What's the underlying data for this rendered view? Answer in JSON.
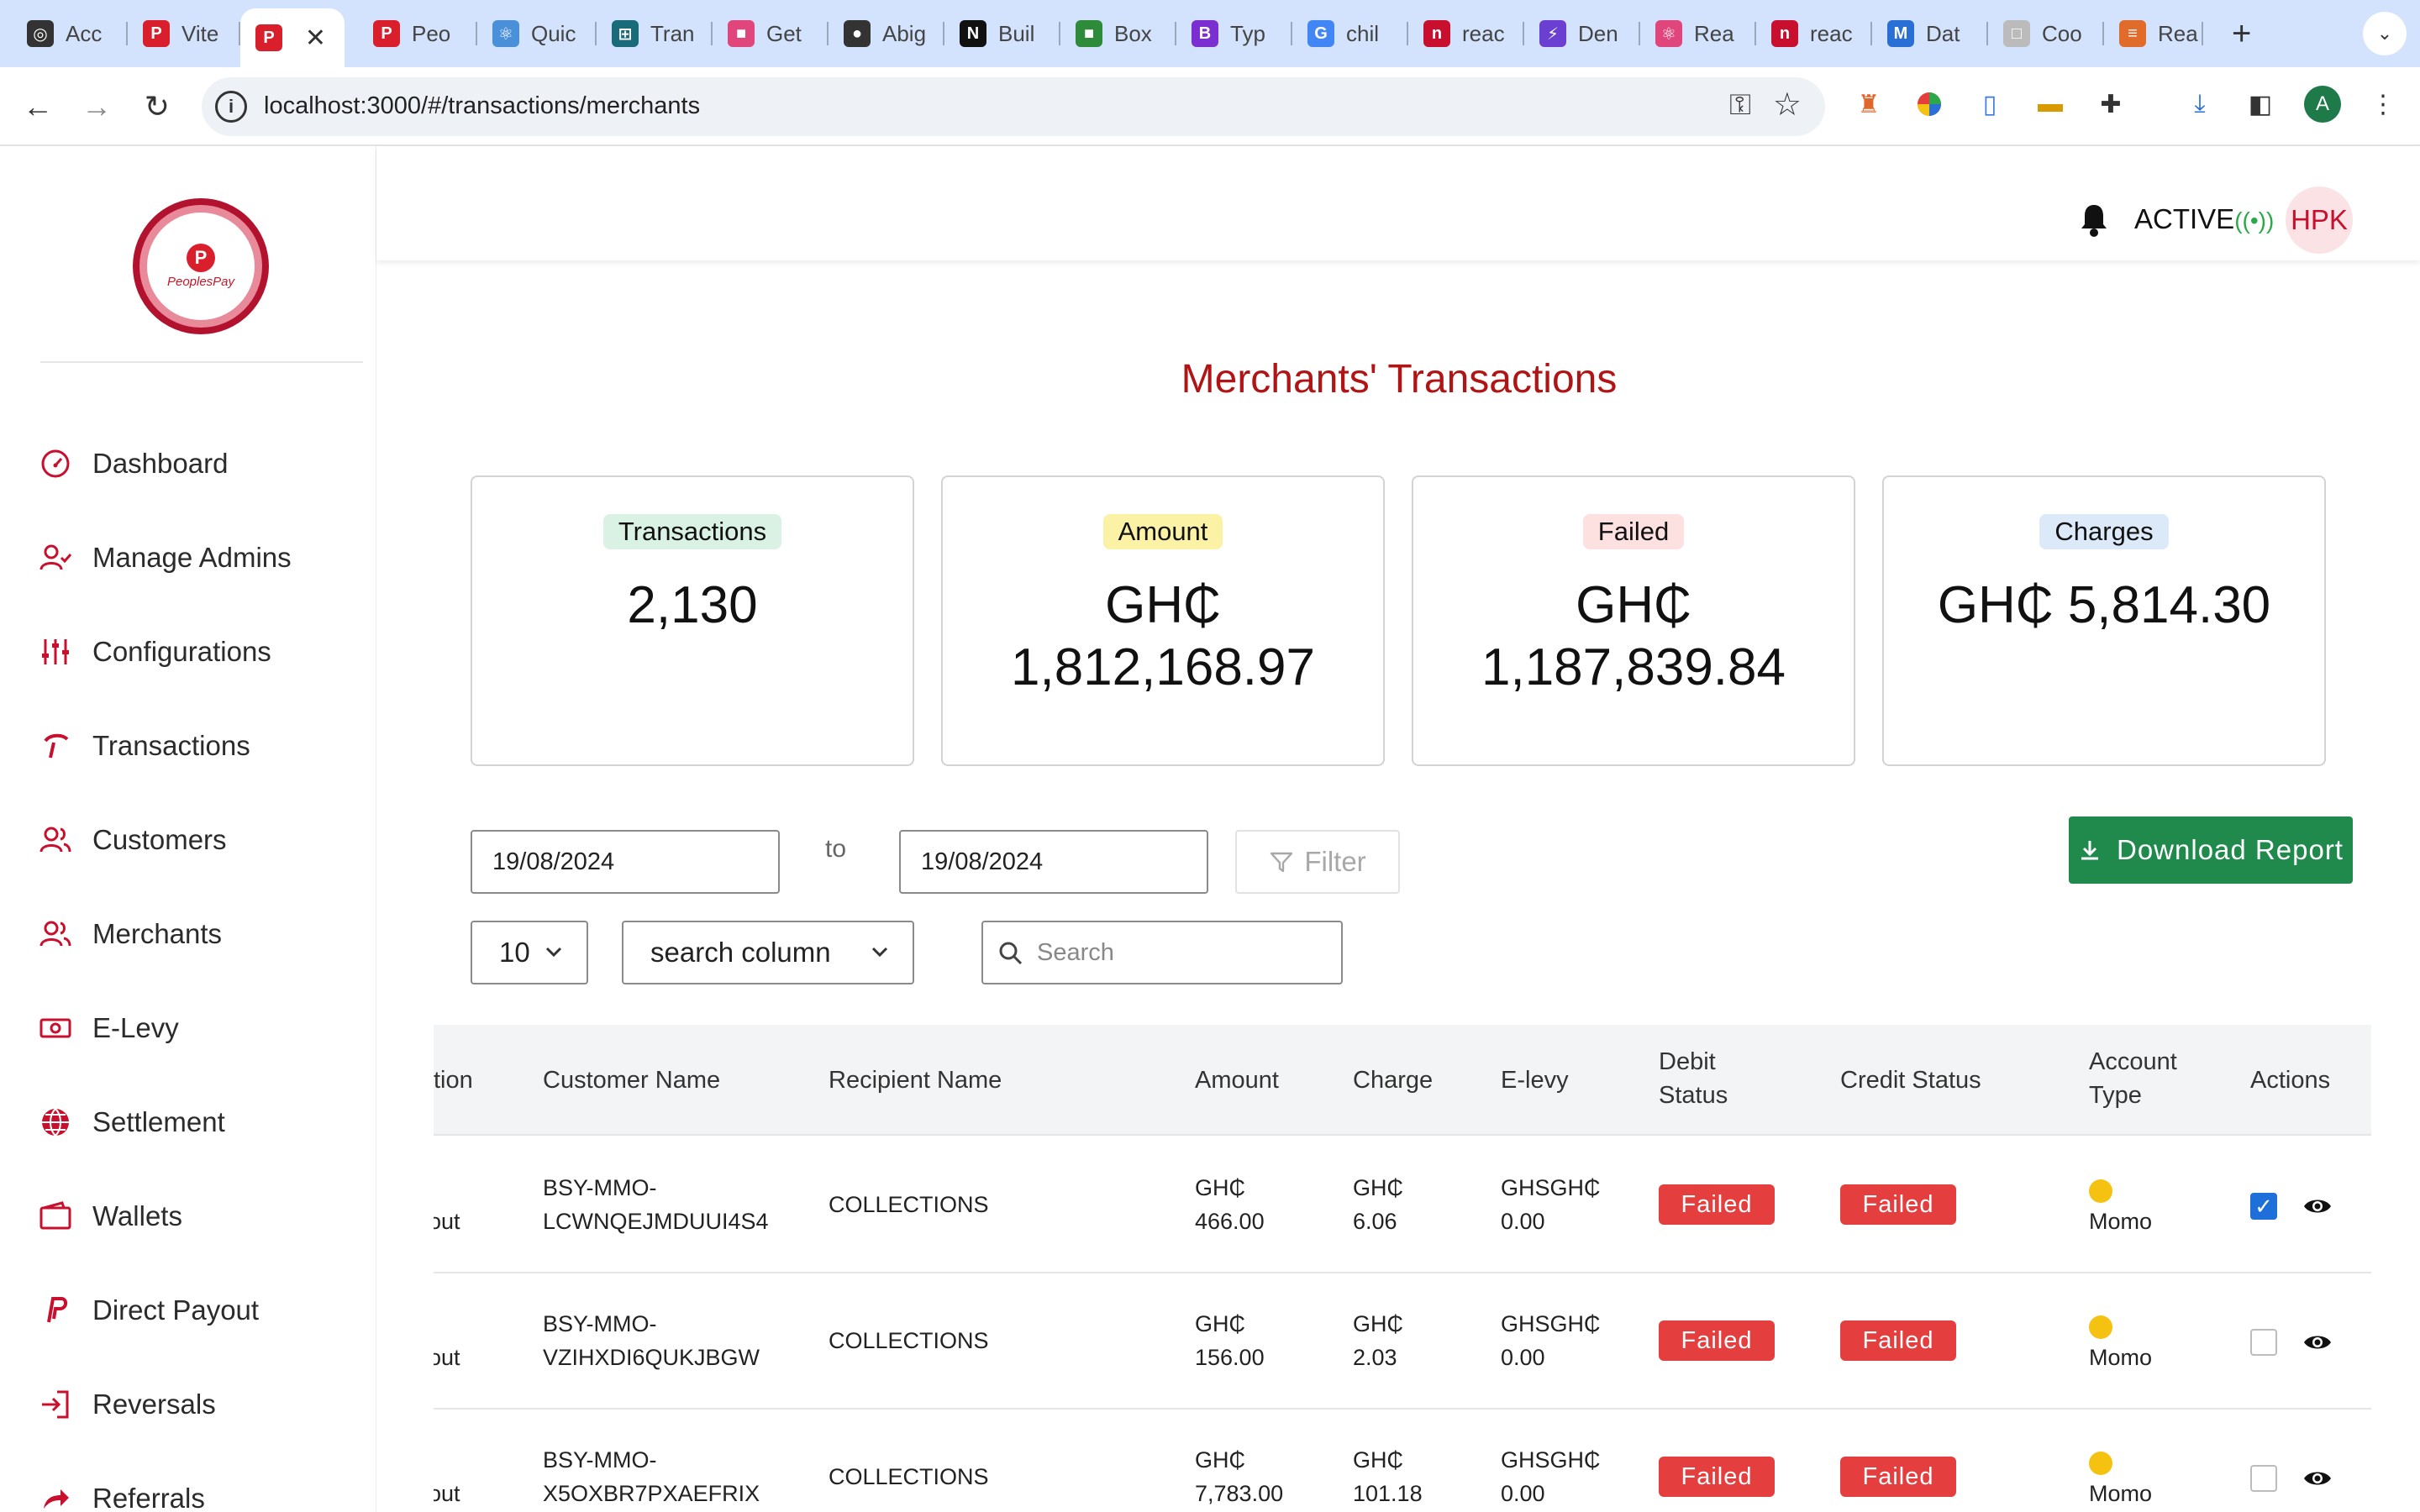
{
  "browser": {
    "tabs": [
      {
        "title": "Acc",
        "color": "#333333",
        "glyph": "◎"
      },
      {
        "title": "Vite",
        "color": "#d81f2b",
        "glyph": "P"
      },
      {
        "title": "",
        "color": "#d81f2b",
        "glyph": "P",
        "active": true
      },
      {
        "title": "Peo",
        "color": "#d81f2b",
        "glyph": "P"
      },
      {
        "title": "Quic",
        "color": "#4a90d9",
        "glyph": "⚛"
      },
      {
        "title": "Tran",
        "color": "#1a6b7a",
        "glyph": "⊞"
      },
      {
        "title": "Get",
        "color": "#e0457b",
        "glyph": "■"
      },
      {
        "title": "Abig",
        "color": "#333333",
        "glyph": "●"
      },
      {
        "title": "Buil",
        "color": "#111111",
        "glyph": "N"
      },
      {
        "title": "Box",
        "color": "#2e8b3a",
        "glyph": "■"
      },
      {
        "title": "Typ",
        "color": "#7b2fd1",
        "glyph": "B"
      },
      {
        "title": "chil",
        "color": "#4285f4",
        "glyph": "G"
      },
      {
        "title": "reac",
        "color": "#c8102e",
        "glyph": "n"
      },
      {
        "title": "Den",
        "color": "#6b3fd1",
        "glyph": "⚡"
      },
      {
        "title": "Rea",
        "color": "#e0457b",
        "glyph": "⚛"
      },
      {
        "title": "reac",
        "color": "#c8102e",
        "glyph": "n"
      },
      {
        "title": "Dat",
        "color": "#2a6fd6",
        "glyph": "M"
      },
      {
        "title": "Coo",
        "color": "#bbbbbb",
        "glyph": "□"
      },
      {
        "title": "Rea",
        "color": "#e06b2b",
        "glyph": "≡"
      }
    ],
    "url": "localhost:3000/#/transactions/merchants",
    "profile_initial": "A"
  },
  "sidebar": {
    "logo_text": "PeoplesPay",
    "items": [
      {
        "label": "Dashboard",
        "icon": "gauge-icon"
      },
      {
        "label": "Manage Admins",
        "icon": "user-check-icon"
      },
      {
        "label": "Configurations",
        "icon": "sliders-icon"
      },
      {
        "label": "Transactions",
        "icon": "transfer-icon"
      },
      {
        "label": "Customers",
        "icon": "users-icon"
      },
      {
        "label": "Merchants",
        "icon": "users-icon"
      },
      {
        "label": "E-Levy",
        "icon": "money-icon"
      },
      {
        "label": "Settlement",
        "icon": "globe-icon"
      },
      {
        "label": "Wallets",
        "icon": "wallet-icon"
      },
      {
        "label": "Direct Payout",
        "icon": "paypal-icon"
      },
      {
        "label": "Reversals",
        "icon": "login-icon"
      },
      {
        "label": "Referrals",
        "icon": "share-icon"
      }
    ]
  },
  "header": {
    "status_label": "ACTIVE",
    "status_signal": "((•))",
    "avatar": "HPK"
  },
  "main": {
    "title": "Merchants' Transactions",
    "cards": [
      {
        "label": "Transactions",
        "value": "2,130",
        "badge_color": "#d9f2e4"
      },
      {
        "label": "Amount",
        "value": "GH₵ 1,812,168.97",
        "badge_color": "#fbf2a6"
      },
      {
        "label": "Failed",
        "value": "GH₵ 1,187,839.84",
        "badge_color": "#fde0e0"
      },
      {
        "label": "Charges",
        "value": "GH₵ 5,814.30",
        "badge_color": "#dbe9f8"
      }
    ],
    "date_from": "19/08/2024",
    "to_label": "to",
    "date_to": "19/08/2024",
    "filter_label": "Filter",
    "download_label": "Download Report",
    "page_size": "10",
    "search_column": "search column",
    "search_placeholder": "Search"
  },
  "table": {
    "columns": [
      "tion",
      "Customer Name",
      "Recipient Name",
      "Amount",
      "Charge",
      "E-levy",
      "Debit Status",
      "Credit Status",
      "Account Type",
      "Actions"
    ],
    "rows": [
      {
        "type_partial": "out",
        "customer_1": "BSY-MMO-",
        "customer_2": "LCWNQEJMDUUI4S4",
        "recipient": "COLLECTIONS",
        "amount_cur": "GH₵",
        "amount": "466.00",
        "charge_cur": "GH₵",
        "charge": "6.06",
        "elevy_cur": "GHSGH₵",
        "elevy": "0.00",
        "debit": "Failed",
        "credit": "Failed",
        "account": "Momo",
        "checked": true
      },
      {
        "type_partial": "out",
        "customer_1": "BSY-MMO-",
        "customer_2": "VZIHXDI6QUKJBGW",
        "recipient": "COLLECTIONS",
        "amount_cur": "GH₵",
        "amount": "156.00",
        "charge_cur": "GH₵",
        "charge": "2.03",
        "elevy_cur": "GHSGH₵",
        "elevy": "0.00",
        "debit": "Failed",
        "credit": "Failed",
        "account": "Momo",
        "checked": false
      },
      {
        "type_partial": "out",
        "customer_1": "BSY-MMO-",
        "customer_2": "X5OXBR7PXAEFRIX",
        "recipient": "COLLECTIONS",
        "amount_cur": "GH₵",
        "amount": "7,783.00",
        "charge_cur": "GH₵",
        "charge": "101.18",
        "elevy_cur": "GHSGH₵",
        "elevy": "0.00",
        "debit": "Failed",
        "credit": "Failed",
        "account": "Momo",
        "checked": false
      }
    ]
  },
  "colors": {
    "accent": "#c8102e",
    "title": "#b01414",
    "success": "#1f8a4c",
    "failed": "#e53e3e",
    "momo_dot": "#f5c211"
  }
}
